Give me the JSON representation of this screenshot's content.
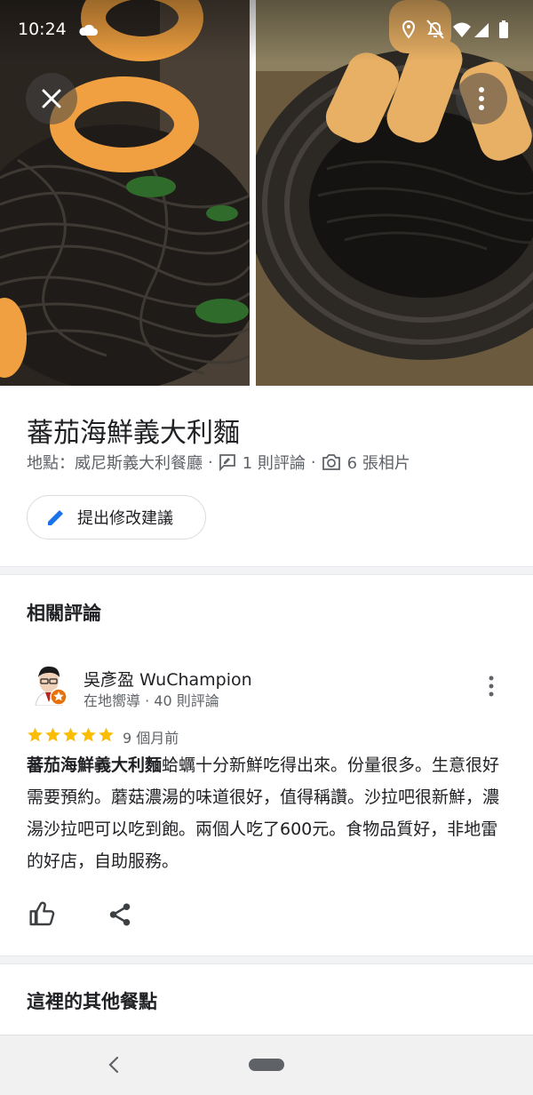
{
  "status_bar": {
    "time": "10:24"
  },
  "place": {
    "title": "蕃茄海鮮義大利麵",
    "location": "地點：威尼斯義大利餐廳",
    "reviews_count": "1 則評論",
    "photos_count": "6 張相片"
  },
  "actions": {
    "suggest_edit": "提出修改建議"
  },
  "reviews_section": {
    "title": "相關評論",
    "review": {
      "author": "吳彥盈 WuChampion",
      "author_sub": "在地嚮導 · 40 則評論",
      "rating": 5,
      "time": "9 個月前",
      "dish": "蕃茄海鮮義大利麵",
      "text": "蛤蠣十分新鮮吃得出來。份量很多。生意很好需要預約。蘑菇濃湯的味道很好，值得稱讚。沙拉吧很新鮮，濃湯沙拉吧可以吃到飽。兩個人吃了600元。食物品質好，非地雷的好店，自助服務。"
    }
  },
  "other_section": {
    "title": "這裡的其他餐點"
  },
  "colors": {
    "star": "#fbbc04",
    "accent": "#1a73e8",
    "badge": "#e8710a"
  }
}
